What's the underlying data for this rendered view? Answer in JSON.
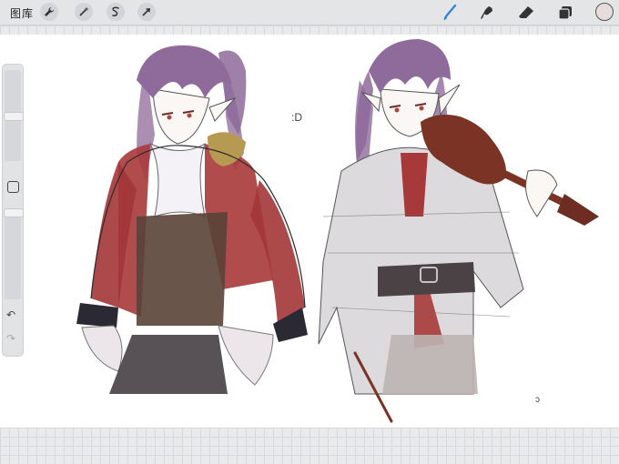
{
  "toolbar": {
    "gallery_label": "图库",
    "left_tools": [
      "wrench-icon",
      "magic-wand-icon",
      "selection-icon",
      "transform-arrow-icon"
    ],
    "right_tools": [
      "brush-icon",
      "smudge-icon",
      "eraser-icon",
      "layers-icon"
    ],
    "active_tool": "brush-icon",
    "accent_color": "#2f7fe0",
    "current_color": "#e6dcdc"
  },
  "canvas": {
    "doodle_text": ":D"
  },
  "sidebar": {
    "undo_icon": "↶",
    "redo_icon": "↷"
  }
}
